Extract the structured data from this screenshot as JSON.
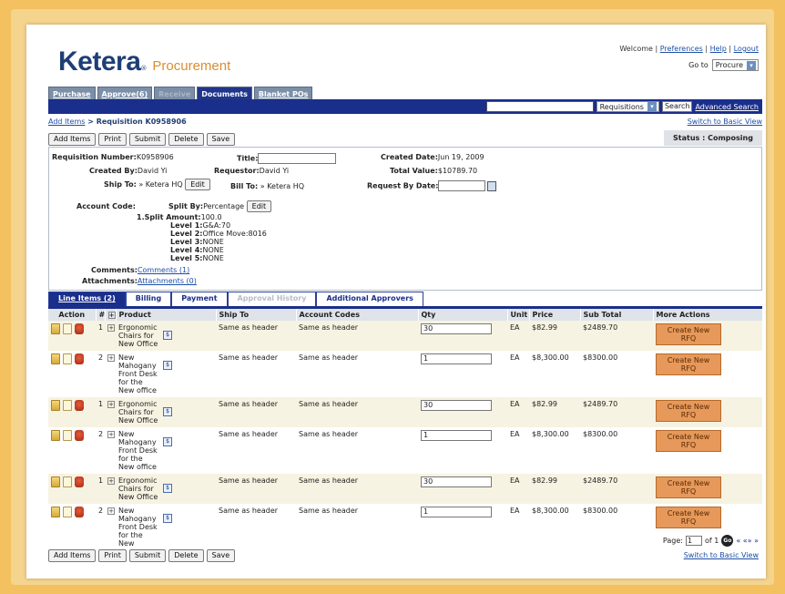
{
  "brand": {
    "name": "Ketera",
    "reg": "®",
    "product": "Procurement"
  },
  "header": {
    "welcome": "Welcome",
    "links": [
      "Preferences",
      "Help",
      "Logout"
    ],
    "goto_label": "Go to",
    "goto_value": "Procure"
  },
  "tabs": [
    "Purchase",
    "Approve(6)",
    "Receive",
    "Documents",
    "Blanket POs"
  ],
  "searchbar": {
    "type": "Requisitions",
    "button": "Search",
    "advanced": "Advanced Search"
  },
  "breadcrumb": {
    "link": "Add Items",
    "sep": ">",
    "current": "Requisition K0958906"
  },
  "switch_view": "Switch to Basic View",
  "buttons": {
    "add_items": "Add Items",
    "print": "Print",
    "submit": "Submit",
    "delete": "Delete",
    "save": "Save"
  },
  "status": "Status : Composing",
  "details": {
    "req_number_label": "Requisition Number:",
    "req_number": "K0958906",
    "title_label": "Title:",
    "created_date_label": "Created Date:",
    "created_date": "Jun 19, 2009",
    "created_by_label": "Created By:",
    "created_by": "David Yi",
    "requestor_label": "Requestor:",
    "requestor": "David Yi",
    "total_value_label": "Total Value:",
    "total_value": "$10789.70",
    "ship_to_label": "Ship To:",
    "ship_to": "» Ketera HQ",
    "bill_to_label": "Bill To:",
    "bill_to": "» Ketera HQ",
    "request_by_label": "Request By Date:",
    "edit": "Edit",
    "account_code_label": "Account Code:",
    "split_by_label": "Split By:",
    "split_by": "Percentage",
    "split_amount_label": "1.Split Amount:",
    "split_amount": "100.0",
    "levels": [
      {
        "label": "Level 1:",
        "value": "G&A:70"
      },
      {
        "label": "Level 2:",
        "value": "Office Move:8016"
      },
      {
        "label": "Level 3:",
        "value": "NONE"
      },
      {
        "label": "Level 4:",
        "value": "NONE"
      },
      {
        "label": "Level 5:",
        "value": "NONE"
      }
    ],
    "comments_label": "Comments:",
    "comments": "Comments (1)",
    "attachments_label": "Attachments:",
    "attachments": "Attachments (0)"
  },
  "subtabs": [
    "Line Items (2)",
    "Billing",
    "Payment",
    "Approval History",
    "Additional Approvers"
  ],
  "table": {
    "headers": [
      "Action",
      "#",
      "",
      "Product",
      "Ship To",
      "Account Codes",
      "Qty",
      "Unit",
      "Price",
      "Sub Total",
      "More Actions"
    ],
    "rows": [
      {
        "num": "1",
        "product": "Ergonomic Chairs for New Office",
        "ship_to": "Same as header",
        "account": "Same as header",
        "qty": "30",
        "unit": "EA",
        "price": "$82.99",
        "subtotal": "$2489.70",
        "action": "Create New RFQ"
      },
      {
        "num": "2",
        "product": "New Mahogany Front Desk for the New office",
        "ship_to": "Same as header",
        "account": "Same as header",
        "qty": "1",
        "unit": "EA",
        "price": "$8,300.00",
        "subtotal": "$8300.00",
        "action": "Create New RFQ"
      },
      {
        "num": "1",
        "product": "Ergonomic Chairs for New Office",
        "ship_to": "Same as header",
        "account": "Same as header",
        "qty": "30",
        "unit": "EA",
        "price": "$82.99",
        "subtotal": "$2489.70",
        "action": "Create New RFQ"
      },
      {
        "num": "2",
        "product": "New Mahogany Front Desk for the New office",
        "ship_to": "Same as header",
        "account": "Same as header",
        "qty": "1",
        "unit": "EA",
        "price": "$8,300.00",
        "subtotal": "$8300.00",
        "action": "Create New RFQ"
      },
      {
        "num": "1",
        "product": "Ergonomic Chairs for New Office",
        "ship_to": "Same as header",
        "account": "Same as header",
        "qty": "30",
        "unit": "EA",
        "price": "$82.99",
        "subtotal": "$2489.70",
        "action": "Create New RFQ"
      },
      {
        "num": "2",
        "product": "New Mahogany Front Desk for the New",
        "ship_to": "Same as header",
        "account": "Same as header",
        "qty": "1",
        "unit": "EA",
        "price": "$8,300.00",
        "subtotal": "$8300.00",
        "action": "Create New RFQ"
      }
    ]
  },
  "pager": {
    "label": "Page:",
    "page": "1",
    "of": "of 1",
    "go": "Go",
    "nav": "« «» »"
  }
}
